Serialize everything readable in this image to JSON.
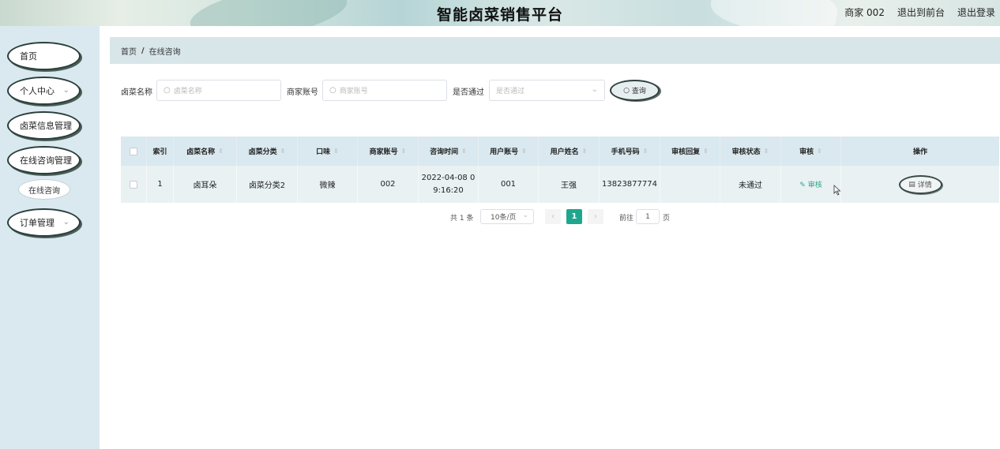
{
  "header": {
    "title": "智能卤菜销售平台",
    "user": "商家 002",
    "back_front": "退出到前台",
    "logout": "退出登录"
  },
  "sidebar": {
    "items": [
      {
        "label": "首页",
        "icon": "none"
      },
      {
        "label": "个人中心",
        "icon": "chevron-down-icon"
      },
      {
        "label": "卤菜信息管理",
        "icon": "none"
      },
      {
        "label": "在线咨询管理",
        "icon": "none"
      },
      {
        "label": "订单管理",
        "icon": "chevron-down-icon"
      }
    ],
    "sub_item": "在线咨询"
  },
  "breadcrumb": {
    "home": "首页",
    "separator": "/",
    "current": "在线咨询"
  },
  "search": {
    "field1_label": "卤菜名称",
    "field1_placeholder": "卤菜名称",
    "field2_label": "商家账号",
    "field2_placeholder": "商家账号",
    "field3_label": "是否通过",
    "field3_placeholder": "是否通过",
    "query_button": "查询"
  },
  "table": {
    "headers": [
      "索引",
      "卤菜名称",
      "卤菜分类",
      "口味",
      "商家账号",
      "咨询时间",
      "用户账号",
      "用户姓名",
      "手机号码",
      "审核回复",
      "审核状态",
      "审核",
      "操作"
    ],
    "rows": [
      {
        "index": "1",
        "name": "卤耳朵",
        "category": "卤菜分类2",
        "taste": "微辣",
        "merchant": "002",
        "time_line1": "2022-04-08 0",
        "time_line2": "9:16:20",
        "user_account": "001",
        "user_name": "王强",
        "phone": "13823877774",
        "reply": "",
        "status": "未通过",
        "audit_link": "审核",
        "detail_button": "详情"
      }
    ]
  },
  "pagination": {
    "total": "共 1 条",
    "page_size": "10条/页",
    "current_page": "1",
    "goto_prefix": "前往",
    "goto_value": "1",
    "goto_suffix": "页"
  },
  "colors": {
    "accent": "#1ea78e",
    "sidebar_bg": "#d9e9ef",
    "row_bg": "#e9f1f3"
  }
}
